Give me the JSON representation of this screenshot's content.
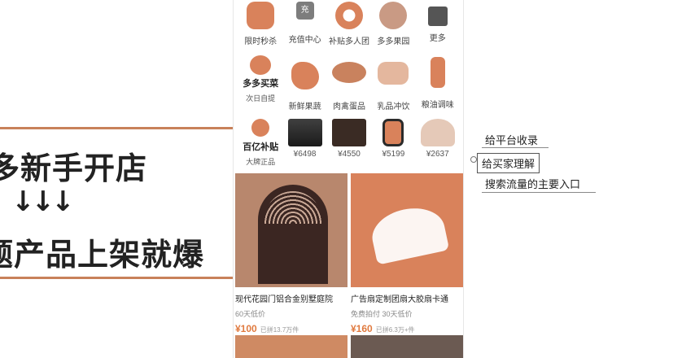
{
  "slide": {
    "line1": "多新手开店",
    "arrows": "↓↓↓",
    "line3": "题产品上架就爆"
  },
  "app": {
    "row1": [
      {
        "label": "限时秒杀",
        "icon": "alarm-clock-icon"
      },
      {
        "label": "充值中心",
        "icon": "charge-icon",
        "glyph": "充"
      },
      {
        "label": "补贴多人团",
        "icon": "group-icon"
      },
      {
        "label": "多多果园",
        "icon": "orchard-icon"
      },
      {
        "label": "更多",
        "icon": "more-icon"
      }
    ],
    "row2": {
      "promo_title": "多多买菜",
      "promo_sub": "次日自提",
      "items": [
        {
          "label": "新鲜果蔬",
          "icon": "fruit-icon"
        },
        {
          "label": "肉禽蛋品",
          "icon": "meat-icon"
        },
        {
          "label": "乳品冲饮",
          "icon": "dairy-icon"
        },
        {
          "label": "粮油调味",
          "icon": "oil-icon"
        }
      ]
    },
    "row3": {
      "promo_title": "百亿补贴",
      "promo_sub": "大牌正品",
      "items": [
        {
          "price": "¥6498",
          "icon": "tv-icon"
        },
        {
          "price": "¥4550",
          "icon": "computer-icon"
        },
        {
          "price": "¥5199",
          "icon": "watch-icon"
        },
        {
          "price": "¥2637",
          "icon": "scooter-icon"
        }
      ]
    },
    "cards": [
      {
        "title": "现代花园门铝合金别墅庭院",
        "sub": "60天低价",
        "price": "¥100",
        "sold": "已拼13.7万件"
      },
      {
        "title": "广告扇定制团扇大胶扇卡通",
        "sub": "免费拍付 30天低价",
        "price": "¥160",
        "sold": "已拼6.3万+件"
      }
    ]
  },
  "mindmap": {
    "nodes": [
      "给平台收录",
      "给买家理解",
      "搜索流量的主要入口"
    ]
  },
  "colors": {
    "accent": "#d9825b",
    "price": "#e07a3f",
    "rule": "#c8815a"
  }
}
